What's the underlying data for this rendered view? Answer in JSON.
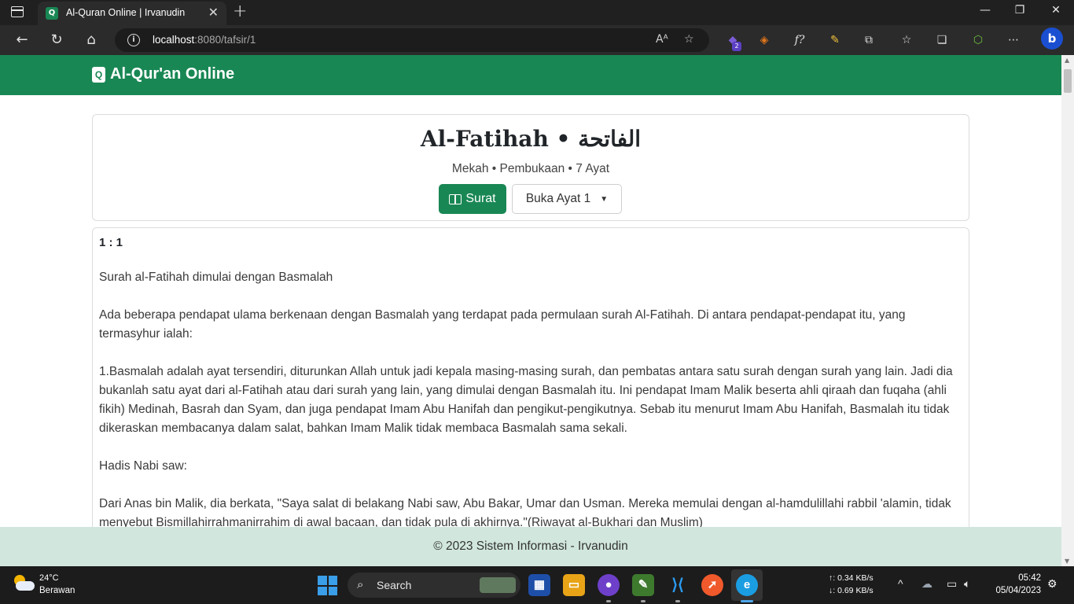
{
  "browser": {
    "tab_title": "Al-Quran Online | Irvanudin",
    "url_host": "localhost",
    "url_rest": ":8080/tafsir/1",
    "extension_badge": "2"
  },
  "site": {
    "brand": "Al-Qur'an Online",
    "brand_color": "#198754"
  },
  "surah": {
    "title": "Al-Fatihah • الفاتحة",
    "meta": "Mekah • Pembukaan • 7 Ayat",
    "surat_button": "Surat",
    "ayat_dropdown": "Buka Ayat 1"
  },
  "tafsir": {
    "ayat_ref": "1 : 1",
    "paragraphs": [
      "Surah al-Fatihah dimulai dengan Basmalah",
      "Ada beberapa pendapat ulama berkenaan dengan Basmalah yang terdapat pada permulaan surah Al-Fatihah. Di antara pendapat-pendapat itu, yang termasyhur ialah:",
      "1.Basmalah adalah ayat tersendiri, diturunkan Allah untuk jadi kepala masing-masing surah, dan pembatas antara satu surah dengan surah yang lain. Jadi dia bukanlah satu ayat dari al-Fatihah atau dari surah yang lain, yang dimulai dengan Basmalah itu. Ini pendapat Imam Malik beserta ahli qiraah dan fuqaha (ahli fikih) Medinah, Basrah dan Syam, dan juga pendapat Imam Abu Hanifah dan pengikut-pengikutnya. Sebab itu menurut Imam Abu Hanifah, Basmalah itu tidak dikeraskan membacanya dalam salat, bahkan Imam Malik tidak membaca Basmalah sama sekali.",
      "Hadis Nabi saw:",
      "Dari Anas bin Malik, dia berkata, \"Saya salat di belakang Nabi saw, Abu Bakar, Umar dan Usman. Mereka memulai dengan al-hamdulillahi rabbil 'alamin, tidak menyebut Bismillahirrahmanirrahim di awal bacaan, dan tidak pula di akhirnya.\"(Riwayat al-Bukhari dan Muslim)"
    ]
  },
  "footer": {
    "text": "© 2023 Sistem Informasi - Irvanudin"
  },
  "taskbar": {
    "temperature": "24°C",
    "weather": "Berawan",
    "search_label": "Search",
    "net_up": "↑: 0.34 KB/s",
    "net_down": "↓: 0.69 KB/s",
    "time": "05:42",
    "date": "05/04/2023"
  }
}
